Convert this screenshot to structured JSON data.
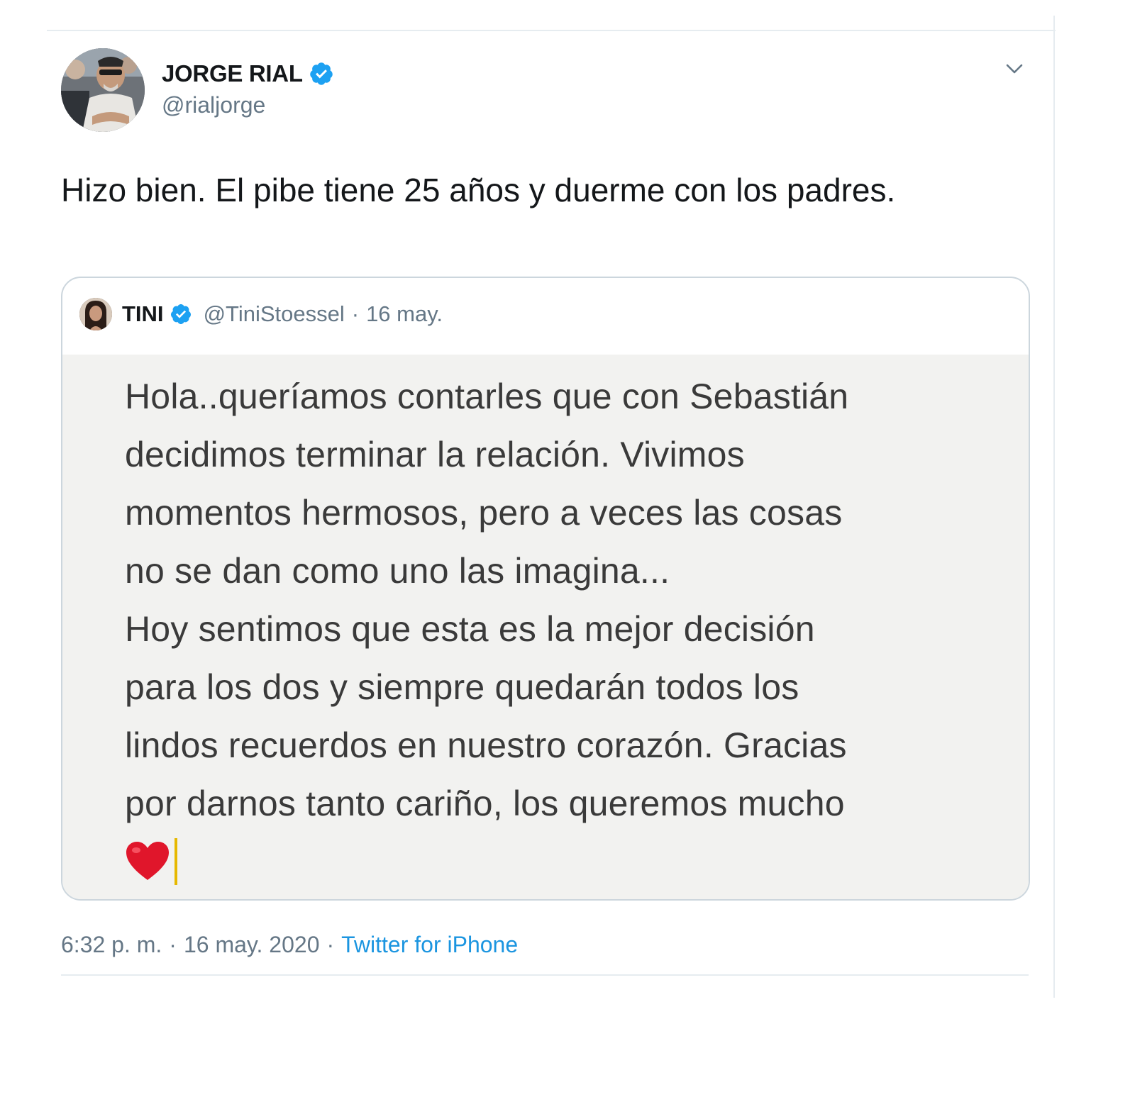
{
  "author": {
    "name": "JORGE RIAL",
    "handle": "@rialjorge",
    "verified": true,
    "avatar_icon": "profile-photo"
  },
  "tweet": {
    "text": "Hizo bien. El pibe tiene 25 años y duerme con los padres."
  },
  "quoted_tweet": {
    "name": "TINI",
    "handle": "@TiniStoessel",
    "separator": "·",
    "date": "16 may.",
    "verified": true,
    "image_text_lines": [
      "Hola..queríamos contarles que con Sebastián",
      "decidimos terminar la relación. Vivimos",
      "momentos hermosos, pero a veces las cosas",
      "no se dan como uno las imagina...",
      "Hoy sentimos que esta es la mejor decisión",
      "para los dos y siempre quedarán todos los",
      "lindos recuerdos en nuestro corazón. Gracias",
      "por darnos tanto cariño, los queremos mucho"
    ],
    "emoji": "❤️"
  },
  "meta": {
    "time": "6:32 p. m.",
    "separator": "·",
    "date": "16 may. 2020",
    "source": "Twitter for iPhone"
  },
  "colors": {
    "verified_blue": "#1da1f2",
    "link_blue": "#1b95e0",
    "secondary_text": "#657786",
    "border": "#ccd6dd"
  }
}
